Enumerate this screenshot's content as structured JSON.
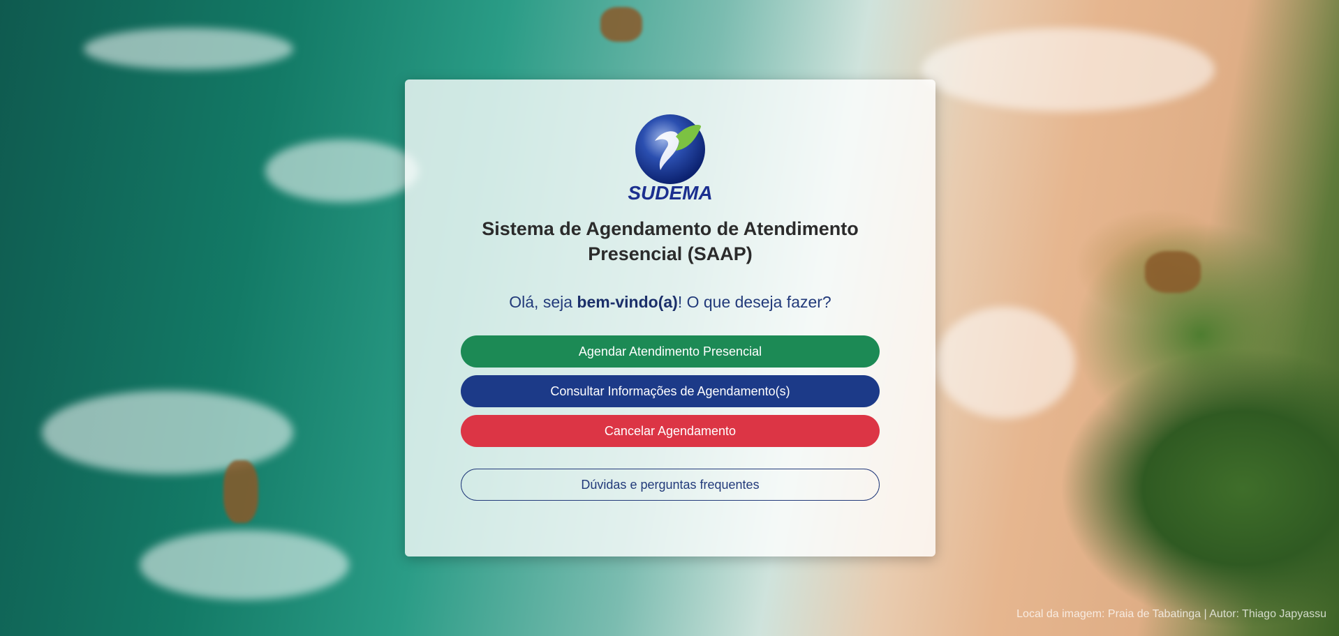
{
  "logo": {
    "icon": "sudema-logo-icon",
    "text": "SUDEMA"
  },
  "title": "Sistema de Agendamento de Atendimento Presencial (SAAP)",
  "welcome": {
    "prefix": "Olá, seja ",
    "emphasis": "bem-vindo(a)",
    "suffix": "! O que deseja fazer?"
  },
  "buttons": {
    "schedule": "Agendar Atendimento Presencial",
    "consult": "Consultar Informações de Agendamento(s)",
    "cancel": "Cancelar Agendamento",
    "faq": "Dúvidas e perguntas frequentes"
  },
  "colors": {
    "schedule": "#1c8a55",
    "consult": "#1c3a88",
    "cancel": "#dc3545",
    "outline": "#223a7a"
  },
  "footer": {
    "credit": "Local da imagem: Praia de Tabatinga | Autor: Thiago Japyassu"
  }
}
